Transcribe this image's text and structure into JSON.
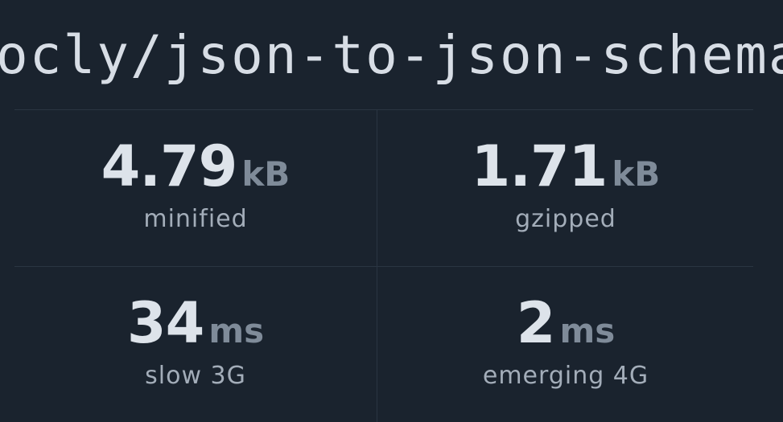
{
  "package": {
    "name": "ocly/json-to-json-schema",
    "verified_icon": "check-circle-icon",
    "verified_color": "#3a9a52"
  },
  "stats": {
    "minified": {
      "value": "4.79",
      "unit": "kB",
      "label": "minified"
    },
    "gzipped": {
      "value": "1.71",
      "unit": "kB",
      "label": "gzipped"
    },
    "slow3g": {
      "value": "34",
      "unit": "ms",
      "label": "slow 3G"
    },
    "emerging4g": {
      "value": "2",
      "unit": "ms",
      "label": "emerging 4G"
    }
  },
  "colors": {
    "background": "#1a232e",
    "value": "#dde3ea",
    "unit": "#7f8b99",
    "label": "#a3adb9",
    "divider": "#2a3542"
  }
}
